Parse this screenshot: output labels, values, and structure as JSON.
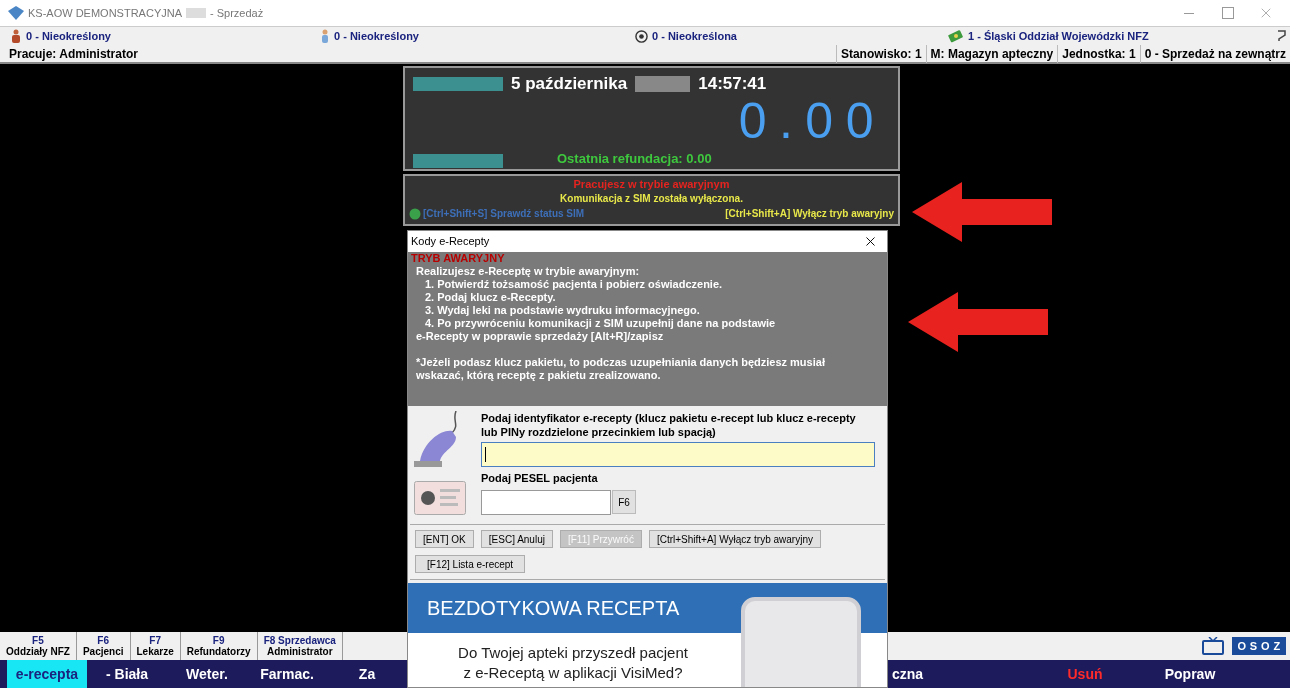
{
  "window": {
    "title": "KS-AOW DEMONSTRACYJNA",
    "title_suffix": "- Sprzedaż"
  },
  "info_bar": [
    {
      "kind": "patient",
      "text": "0 - Nieokreślony"
    },
    {
      "kind": "doctor",
      "text": "0 - Nieokreślony"
    },
    {
      "kind": "institution",
      "text": "0 - Nieokreślona"
    },
    {
      "kind": "nfz",
      "text": "1 - Śląski Oddział Wojewódzki NFZ"
    }
  ],
  "status_row": {
    "user": "Pracuje: Administrator",
    "cells": [
      "Stanowisko: 1",
      "M: Magazyn apteczny",
      "Jednostka: 1",
      "0 - Sprzedaż na zewnątrz"
    ]
  },
  "display": {
    "date": "5 października",
    "time": "14:57:41",
    "amount": "0.00",
    "refund": "Ostatnia refundacja: 0.00"
  },
  "emergency_panel": {
    "title": "Pracujesz w trybie awaryjnym",
    "message": "Komunikacja z SIM została wyłączona.",
    "check_link": "[Ctrl+Shift+S] Sprawdź status SIM",
    "disable_link": "[Ctrl+Shift+A] Wyłącz tryb awaryjny"
  },
  "fkeys": [
    {
      "key": "F5",
      "label": "Oddziały NFZ"
    },
    {
      "key": "F6",
      "label": "Pacjenci"
    },
    {
      "key": "F7",
      "label": "Lekarze"
    },
    {
      "key": "F9",
      "label": "Refundatorzy"
    },
    {
      "key": "F8 Sprzedawca",
      "label": "Administrator"
    }
  ],
  "logo": "OSOZ",
  "bottom_tabs": {
    "left": [
      {
        "label": "e-recepta",
        "selected": true,
        "kind": "normal"
      },
      {
        "label": "- Biała",
        "selected": false,
        "kind": "normal"
      },
      {
        "label": "Weter.",
        "selected": false,
        "kind": "normal"
      },
      {
        "label": "Farmac.",
        "selected": false,
        "kind": "normal"
      },
      {
        "label": "Za",
        "selected": false,
        "kind": "normal"
      }
    ],
    "right": [
      {
        "label": "czna",
        "selected": false,
        "kind": "normal"
      },
      {
        "label": "Usuń",
        "selected": false,
        "kind": "danger"
      },
      {
        "label": "Popraw",
        "selected": false,
        "kind": "normal"
      }
    ]
  },
  "dialog": {
    "title": "Kody e-Recepty",
    "mode_label": "TRYB AWARYJNY",
    "lines": [
      {
        "text": "Realizujesz e-Receptę w trybie awaryjnym:",
        "indented": false
      },
      {
        "text": "1. Potwierdź tożsamość pacjenta i pobierz oświadczenie.",
        "indented": true
      },
      {
        "text": "2. Podaj klucz e-Recepty.",
        "indented": true
      },
      {
        "text": "3. Wydaj leki na podstawie wydruku informacyjnego.",
        "indented": true
      },
      {
        "text": "4. Po przywróceniu komunikacji z SIM uzupełnij dane na podstawie",
        "indented": true
      },
      {
        "text": "e-Recepty w poprawie sprzedaży [Alt+R]/zapisz",
        "indented": false
      }
    ],
    "note": "*Jeżeli podasz klucz pakietu, to podczas uzupełniania danych będziesz musiał wskazać, którą receptę z pakietu zrealizowano.",
    "id_field": {
      "label": "Podaj identyfikator e-recepty (klucz pakietu e-recept lub klucz e-recepty lub PINy rozdzielone przecinkiem lub spacją)",
      "focused": true
    },
    "pesel_field": {
      "label": "Podaj PESEL pacjenta",
      "button": "F6"
    },
    "buttons": [
      {
        "label": "[ENT] OK",
        "disabled": false
      },
      {
        "label": "[ESC] Anuluj",
        "disabled": false
      },
      {
        "label": "[F11] Przywróć",
        "disabled": true
      },
      {
        "label": "[Ctrl+Shift+A] Wyłącz tryb awaryjny",
        "disabled": false
      },
      {
        "label": "[F12] Lista e-recept",
        "disabled": false
      }
    ],
    "banner": {
      "title": "BEZDOTYKOWA RECEPTA",
      "lines": [
        "Do Twojej apteki przyszedł pacjent",
        "z e-Receptą w aplikacji VisiMed?"
      ]
    }
  }
}
